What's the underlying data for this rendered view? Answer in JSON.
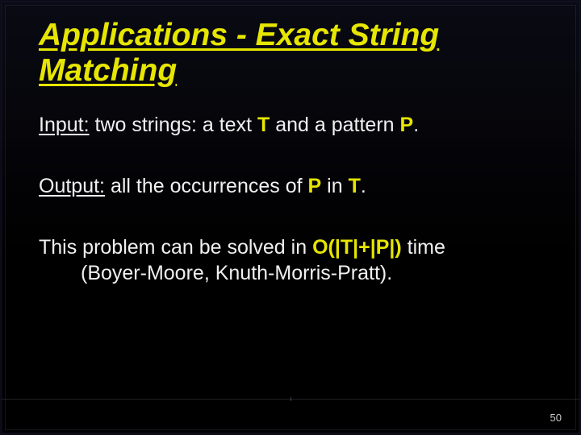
{
  "slide": {
    "title": "Applications - Exact String Matching",
    "input_label": "Input:",
    "input_before_T": " two strings: a text ",
    "sym_T": "T",
    "input_after_T": " and a pattern ",
    "sym_P": "P",
    "input_end": ".",
    "output_label": "Output:",
    "output_before_P": " all the occurrences of ",
    "output_after_P": " in ",
    "output_end": ".",
    "solve_before": "This problem can be solved in ",
    "solve_O": "O(|T|+|P|)",
    "solve_after": " time",
    "solve_line2": "(Boyer-Moore, Knuth-Morris-Pratt).",
    "page_number": "50"
  }
}
